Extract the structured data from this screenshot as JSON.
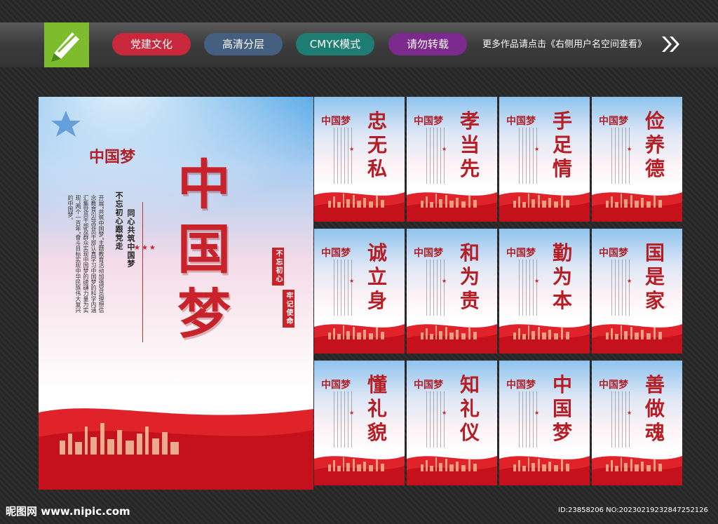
{
  "topbar": {
    "tags": [
      "党建文化",
      "高清分层",
      "CMYK模式",
      "请勿转载"
    ],
    "more_text": "更多作品请点击《右侧用户名空间查看》"
  },
  "main_poster": {
    "title": "中国梦",
    "slogan_1": "不忘初心跟党走",
    "slogan_2": "同心共筑中国梦",
    "body_text": "开展“共筑中国梦”主题教育活动加强党员理想信念教育引导党员干部认真学习中国梦的科学内涵汇集党员干部及群众实现中国梦的磅礴力量为实现“两个一百年”奋斗目标实现中华民族伟大复兴的中国梦。",
    "seal_1": "不忘初心",
    "seal_2": "牢记使命"
  },
  "cards": [
    {
      "title": "忠无私"
    },
    {
      "title": "孝当先"
    },
    {
      "title": "手足情"
    },
    {
      "title": "俭养德"
    },
    {
      "title": "诚立身"
    },
    {
      "title": "和为贵"
    },
    {
      "title": "勤为本"
    },
    {
      "title": "国是家"
    },
    {
      "title": "懂礼貌"
    },
    {
      "title": "知礼仪"
    },
    {
      "title": "中国梦"
    },
    {
      "title": "善做魂"
    }
  ],
  "footer": {
    "site": "昵图网 www.nipic.com",
    "id_text": "ID:23858206 NO:20230219232847252126"
  },
  "colors": {
    "accent_red": "#c8222a",
    "logo_green": "#7cbc2d"
  }
}
